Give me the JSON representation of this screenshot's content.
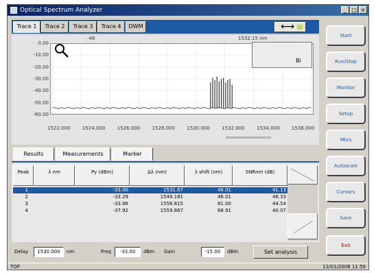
{
  "window": {
    "title": "Optical Spectrum Analyzer",
    "min_glyph": "_",
    "max_glyph": "□",
    "close_glyph": "×"
  },
  "trace_tabs": [
    "Trace 1",
    "Trace 2",
    "Trace 3",
    "Trace 4",
    "DWM"
  ],
  "active_trace_tab": 0,
  "chart_readouts": {
    "left": "-46",
    "right": "1532.15 nm"
  },
  "overlay": {
    "button_label": "Bi"
  },
  "chart_data": {
    "type": "line",
    "title": "",
    "xlabel": "",
    "ylabel": "",
    "y_tick_labels": [
      "0.00",
      "-10.00",
      "-20.00",
      "-30.00",
      "-40.00",
      "-50.00",
      "-60.00"
    ],
    "ylim": [
      -60,
      0
    ],
    "x_tick_labels": [
      "1522.000",
      "1524.000",
      "1526.000",
      "1528.000",
      "1530.000",
      "1532.000",
      "1534.000",
      "1536.000"
    ],
    "xlim": [
      1520,
      1538
    ],
    "grid": true,
    "series": [
      {
        "noise_floor_db": -55,
        "peaks_x": [
          1531.0,
          1531.15,
          1531.3,
          1531.45,
          1531.6,
          1531.75,
          1531.9,
          1532.05,
          1532.2,
          1532.35,
          1532.5
        ],
        "peaks_y": [
          -33,
          -29,
          -31,
          -28,
          -32,
          -30,
          -29,
          -33,
          -31,
          -30,
          -35
        ]
      }
    ]
  },
  "sub_tabs": [
    "Results",
    "Measurements",
    "Marker"
  ],
  "table": {
    "headers": [
      "Peak",
      "λ nm",
      "Py (dBm)",
      "Δλ (nm)",
      "λ shift (nm)",
      "SNRnm (dB)"
    ],
    "rows": [
      {
        "peak": "1",
        "wavelength": "",
        "power": "-33.00",
        "delta": "1531.67",
        "shift": "46.01",
        "snr": "41.13",
        "selected": true
      },
      {
        "peak": "2",
        "wavelength": "",
        "power": "-33.29",
        "delta": "1549.181",
        "shift": "46.01",
        "snr": "46.33",
        "selected": false
      },
      {
        "peak": "3",
        "wavelength": "",
        "power": "-33.86",
        "delta": "1556.815",
        "shift": "81.00",
        "snr": "44.54",
        "selected": false
      },
      {
        "peak": "4",
        "wavelength": "",
        "power": "-37.92",
        "delta": "1559.867",
        "shift": "68.91",
        "snr": "40.07",
        "selected": false
      }
    ]
  },
  "bottom_bar": {
    "label1": "Delay",
    "input1": "1530.000",
    "unit1": "nm",
    "label2": "Freq",
    "input2": "-33.00",
    "unit2": "dBm",
    "label3": "Gain",
    "input3": "-15.00",
    "unit3": "dBm",
    "set_button": "Set analysis"
  },
  "side_buttons": [
    {
      "label": "Start",
      "red": false
    },
    {
      "label": "Run/Stop",
      "red": false
    },
    {
      "label": "Monitor",
      "red": false
    },
    {
      "label": "Setup",
      "red": false
    },
    {
      "label": "Mkrs",
      "red": false
    },
    {
      "label": "Autoscale",
      "red": false
    },
    {
      "label": "Cursors",
      "red": false
    },
    {
      "label": "Save",
      "red": false
    },
    {
      "label": "Exit",
      "red": true
    }
  ],
  "status": {
    "left": "TOP",
    "right": "12/01/2008 11:59"
  }
}
